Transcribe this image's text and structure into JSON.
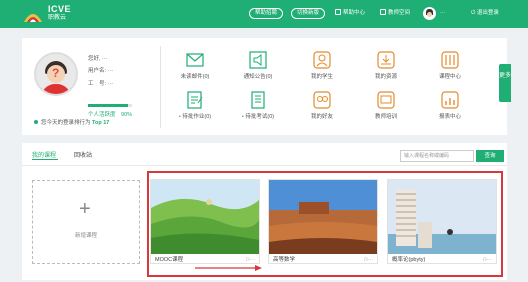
{
  "header": {
    "brand_title": "ICVE",
    "brand_subtitle": "职教云",
    "pill_help": "帮助招聘",
    "pill_switch": "切换新版",
    "nav_help_center": "帮助中心",
    "nav_teacher_home": "教师空间",
    "user_dots": "···",
    "logout": "退出登录"
  },
  "profile": {
    "greeting": "您好, ···",
    "username": "用户名: ···",
    "job_number": "工　号: ···",
    "activity_label": "个人活跃度",
    "activity_value": "90%",
    "activity_fraction": 0.9,
    "rank_text": "您今天的登录排行为",
    "rank_value": "Top 17"
  },
  "features": [
    {
      "label": "未读邮件(0)",
      "icon": "mail-icon"
    },
    {
      "label": "通知公告(0)",
      "icon": "announcement-icon"
    },
    {
      "label": "我的学生",
      "icon": "student-icon"
    },
    {
      "label": "我的资源",
      "icon": "resource-icon"
    },
    {
      "label": "课程中心",
      "icon": "course-center-icon"
    },
    {
      "label": "待批作业(0)",
      "icon": "homework-icon"
    },
    {
      "label": "待批考试(0)",
      "icon": "exam-icon"
    },
    {
      "label": "我的好友",
      "icon": "friends-icon"
    },
    {
      "label": "教师培训",
      "icon": "training-icon"
    },
    {
      "label": "报表中心",
      "icon": "report-icon"
    }
  ],
  "side_tab": "更多",
  "courses_panel": {
    "tab_my_courses": "我的课程",
    "tab_recycle": "回收站",
    "search_placeholder": "输入课程名称或编码",
    "search_button": "查询",
    "new_course_label": "新增课程",
    "courses": [
      {
        "name": "MOOC课程",
        "meta": "···"
      },
      {
        "name": "高等数学",
        "meta": "···"
      },
      {
        "name": "概率论(pbyty)",
        "meta": "···"
      }
    ]
  },
  "colors": {
    "accent": "#1fae73",
    "highlight_border": "#d8383c",
    "arrow": "#d8383c"
  }
}
